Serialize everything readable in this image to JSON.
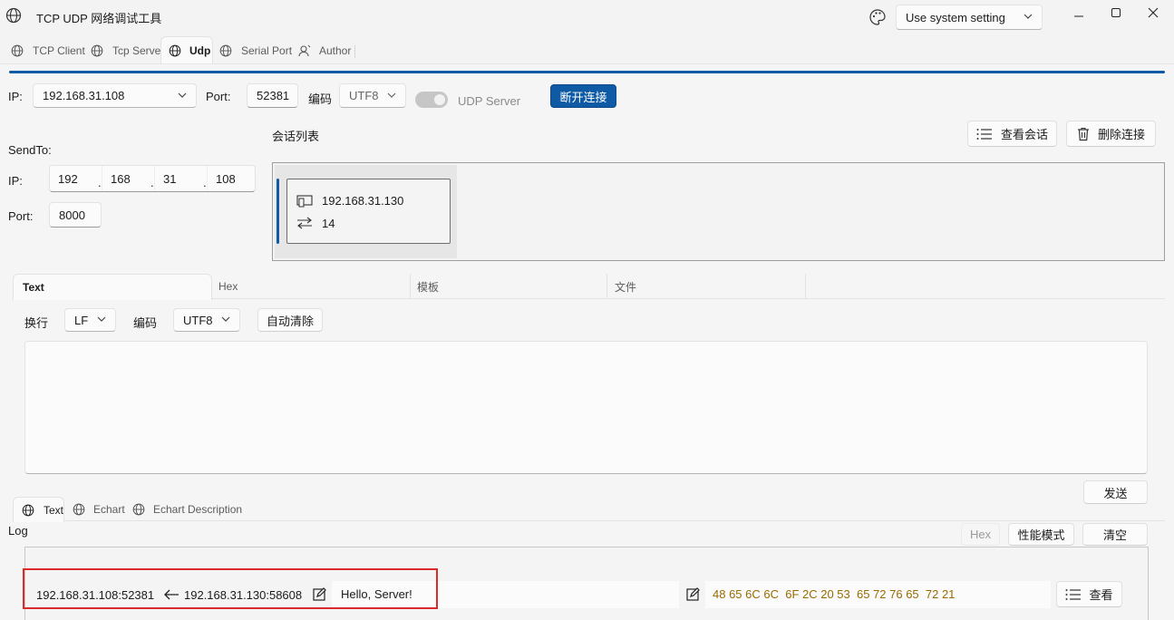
{
  "window": {
    "title": "TCP UDP 网络调试工具",
    "theme_combo": "Use system setting"
  },
  "main_tabs": [
    {
      "label": "TCP Client",
      "active": false
    },
    {
      "label": "Tcp Server",
      "active": false
    },
    {
      "label": "Udp",
      "active": true
    },
    {
      "label": "Serial Port",
      "active": false
    },
    {
      "label": "Author",
      "active": false
    }
  ],
  "conn": {
    "ip_label": "IP:",
    "ip_value": "192.168.31.108",
    "port_label": "Port:",
    "port_value": "52381",
    "encoding_label": "编码",
    "encoding_value": "UTF8",
    "udp_server_label": "UDP Server",
    "disconnect_button": "断开连接"
  },
  "sendto": {
    "title": "SendTo:",
    "ip_label": "IP:",
    "octets": [
      "192",
      "168",
      "31",
      "108"
    ],
    "port_label": "Port:",
    "port_value": "8000"
  },
  "sessions": {
    "title": "会话列表",
    "view_button": "查看会话",
    "delete_button": "删除连接",
    "items": [
      {
        "address": "192.168.31.130",
        "count": "14"
      }
    ]
  },
  "send_tabs": [
    {
      "label": "Text",
      "active": true
    },
    {
      "label": "Hex",
      "active": false
    },
    {
      "label": "模板",
      "active": false
    },
    {
      "label": "文件",
      "active": false
    }
  ],
  "send_options": {
    "newline_label": "换行",
    "newline_value": "LF",
    "encoding_label": "编码",
    "encoding_value": "UTF8",
    "auto_clear_button": "自动清除",
    "send_text": "",
    "send_button": "发送"
  },
  "log_tabs": [
    {
      "label": "Text",
      "active": true
    },
    {
      "label": "Echart",
      "active": false
    },
    {
      "label": "Echart Description",
      "active": false
    }
  ],
  "log": {
    "title": "Log",
    "hex_button": "Hex",
    "perf_button": "性能模式",
    "clear_button": "清空",
    "entries": [
      {
        "local": "192.168.31.108:52381",
        "remote": "192.168.31.130:58608",
        "text": "Hello, Server!",
        "hex": "48 65 6C 6C  6F 2C 20 53  65 72 76 65  72 21",
        "view_button": "查看"
      }
    ]
  },
  "colors": {
    "accent": "#0f5aa5",
    "highlight_box": "#d92b2b",
    "hex_text": "#9a6a00"
  }
}
